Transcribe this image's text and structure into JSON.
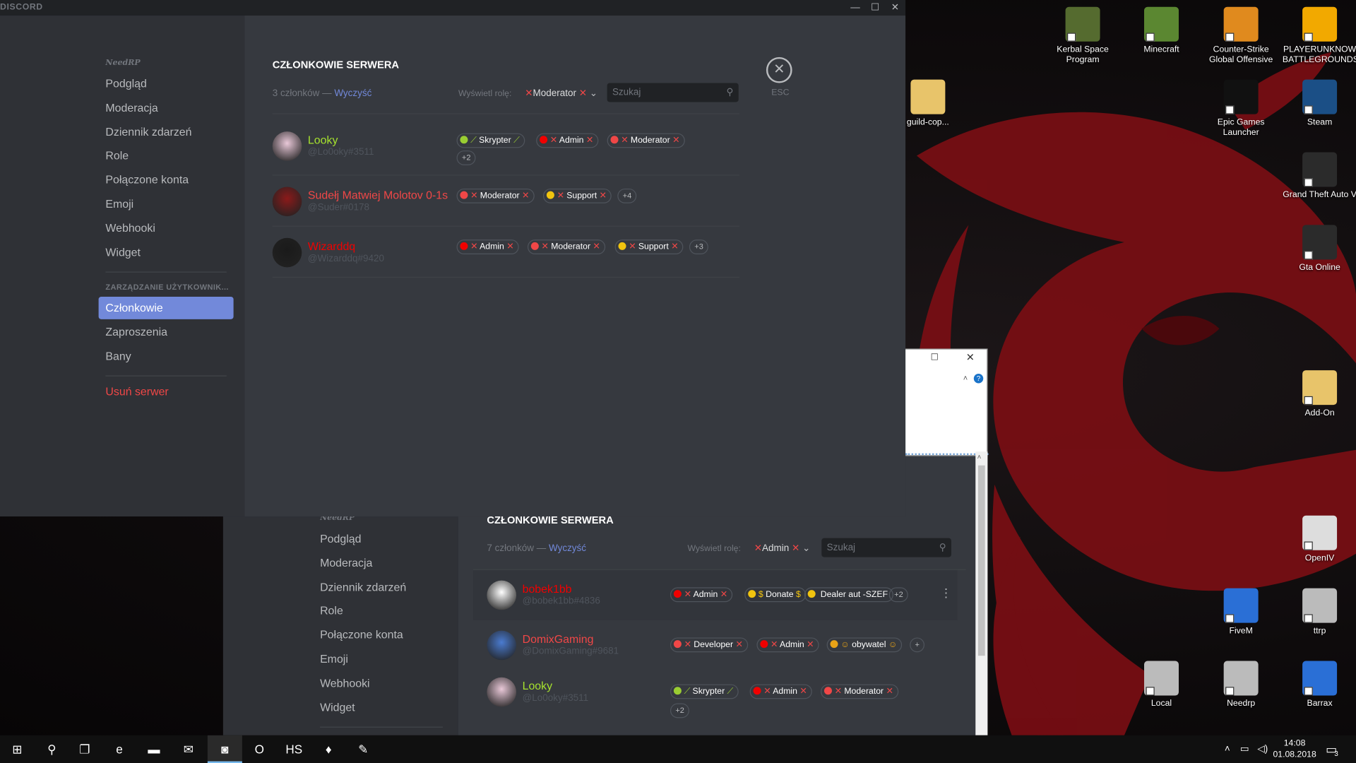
{
  "desktop_icons": [
    {
      "label_lines": [
        "Kerbal Space",
        "Program"
      ],
      "icon": "kerbal-icon",
      "color": "#556b2f"
    },
    {
      "label_lines": [
        "Minecraft"
      ],
      "icon": "minecraft-icon",
      "color": "#5b8731"
    },
    {
      "label_lines": [
        "Counter-Strike",
        "Global Offensive"
      ],
      "icon": "csgo-icon",
      "color": "#e08a1e"
    },
    {
      "label_lines": [
        "PLAYERUNKNOW",
        "BATTLEGROUNDS"
      ],
      "icon": "pubg-icon",
      "color": "#f2a900"
    },
    {
      "label_lines": [
        "Epic Games",
        "Launcher"
      ],
      "icon": "epic-icon",
      "color": "#111111"
    },
    {
      "label_lines": [
        "Steam"
      ],
      "icon": "steam-icon",
      "color": "#1b4f86"
    },
    {
      "label_lines": [
        "Grand Theft Auto V"
      ],
      "icon": "gta-icon",
      "color": "#2b2b2b"
    },
    {
      "label_lines": [
        "Gta Online"
      ],
      "icon": "gta-online-icon",
      "color": "#2b2b2b"
    },
    {
      "label_lines": [
        "Add-On"
      ],
      "icon": "folder-icon",
      "color": "#e8c46a"
    },
    {
      "label_lines": [
        "OpenIV"
      ],
      "icon": "openiv-icon",
      "color": "#dddddd"
    },
    {
      "label_lines": [
        "FiveM"
      ],
      "icon": "fivem-icon",
      "color": "#2a6fd6"
    },
    {
      "label_lines": [
        "ttrp"
      ],
      "icon": "gear-shortcut-icon",
      "color": "#bbbbbb"
    },
    {
      "label_lines": [
        "Local"
      ],
      "icon": "gear-shortcut-icon",
      "color": "#bbbbbb"
    },
    {
      "label_lines": [
        "Needrp"
      ],
      "icon": "gear-shortcut-icon",
      "color": "#bbbbbb"
    },
    {
      "label_lines": [
        "Barrax"
      ],
      "icon": "fivem-icon",
      "color": "#2a6fd6"
    },
    {
      "label_lines": [
        "guild-cop..."
      ],
      "icon": "file-icon",
      "color": "#e8c46a"
    }
  ],
  "discord": {
    "app_name": "DISCORD",
    "window_controls": {
      "minimize": "—",
      "maximize": "☐",
      "close": "✕"
    },
    "front": {
      "server_name": "NeedRP",
      "nav": [
        "Podgląd",
        "Moderacja",
        "Dziennik zdarzeń",
        "Role",
        "Połączone konta",
        "Emoji",
        "Webhooki",
        "Widget"
      ],
      "section_header": "ZARZĄDZANIE UŻYTKOWNIK...",
      "user_nav": [
        "Członkowie",
        "Zaproszenia",
        "Bany"
      ],
      "selected": "Członkowie",
      "delete_server": "Usuń serwer",
      "title": "CZŁONKOWIE SERWERA",
      "count": "3 członków —",
      "clear": "Wyczyść",
      "display_role_label": "Wyświetl rolę:",
      "role_filter": "Moderator",
      "search_placeholder": "Szukaj",
      "close_label": "✕",
      "esc_label": "ESC",
      "members": [
        {
          "name": "Looky",
          "tag": "@Lo0oky#3511",
          "name_color": "#a6e22e",
          "avatar_color": "#e9c8d8",
          "roles": [
            {
              "label": "Skrypter",
              "color": "#9acd32",
              "mark": "⟋"
            },
            {
              "label": "Admin",
              "color": "#f00000",
              "mark": "✕"
            },
            {
              "label": "Moderator",
              "color": "#f04747",
              "mark": "✕"
            }
          ],
          "more": "+2"
        },
        {
          "name": "Sudełj Matwiej Molotov 0-1s",
          "tag": "@Suder#0178",
          "name_color": "#f04747",
          "avatar_color": "#8b1a1a",
          "roles": [
            {
              "label": "Moderator",
              "color": "#f04747",
              "mark": "✕"
            },
            {
              "label": "Support",
              "color": "#f1c40f",
              "mark": "✕"
            }
          ],
          "more": "+4"
        },
        {
          "name": "Wizarddq",
          "tag": "@Wizarddq#9420",
          "name_color": "#f00000",
          "avatar_color": "#1a1a1a",
          "roles": [
            {
              "label": "Admin",
              "color": "#f00000",
              "mark": "✕"
            },
            {
              "label": "Moderator",
              "color": "#f04747",
              "mark": "✕"
            },
            {
              "label": "Support",
              "color": "#f1c40f",
              "mark": "✕"
            }
          ],
          "more": "+3"
        }
      ]
    },
    "back": {
      "server_name": "NeedRP",
      "nav": [
        "Podgląd",
        "Moderacja",
        "Dziennik zdarzeń",
        "Role",
        "Połączone konta",
        "Emoji",
        "Webhooki",
        "Widget"
      ],
      "title": "CZŁONKOWIE SERWERA",
      "count": "7 członków —",
      "clear": "Wyczyść",
      "display_role_label": "Wyświetl rolę:",
      "role_filter": "Admin",
      "search_placeholder": "Szukaj",
      "members": [
        {
          "name": "bobek1bb",
          "tag": "@bobek1bb#4836",
          "name_color": "#f00000",
          "avatar_color": "#ffffff",
          "roles": [
            {
              "label": "Admin",
              "color": "#f00000",
              "prefix": "✕",
              "mark": "✕"
            },
            {
              "label": "Donate",
              "color": "#f1c40f",
              "prefix": "$",
              "mark": "$"
            },
            {
              "label": "Dealer aut -SZEF",
              "color": "#f1c40f",
              "prefix": "",
              "mark": ""
            }
          ],
          "more": "+2"
        },
        {
          "name": "DomixGaming",
          "tag": "@DomixGaming#9681",
          "name_color": "#f04747",
          "avatar_color": "#4a7bd0",
          "roles": [
            {
              "label": "Developer",
              "color": "#f04747",
              "prefix": "✕",
              "mark": "✕"
            },
            {
              "label": "Admin",
              "color": "#f00000",
              "prefix": "✕",
              "mark": "✕"
            },
            {
              "label": "obywatel",
              "color": "#e8a317",
              "prefix": "☺",
              "mark": "☺"
            }
          ],
          "more": "+"
        },
        {
          "name": "Looky",
          "tag": "@Lo0oky#3511",
          "name_color": "#a6e22e",
          "avatar_color": "#e9c8d8",
          "roles": [
            {
              "label": "Skrypter",
              "color": "#9acd32",
              "prefix": "⟋",
              "mark": "⟋"
            },
            {
              "label": "Admin",
              "color": "#f00000",
              "prefix": "✕",
              "mark": "✕"
            },
            {
              "label": "Moderator",
              "color": "#f04747",
              "prefix": "✕",
              "mark": "✕"
            }
          ],
          "more": "+2"
        }
      ]
    }
  },
  "taskbar": {
    "items": [
      {
        "icon": "windows-start-icon",
        "glyph": "⊞"
      },
      {
        "icon": "search-icon",
        "glyph": "⚲"
      },
      {
        "icon": "task-view-icon",
        "glyph": "❐"
      },
      {
        "icon": "edge-icon",
        "glyph": "e"
      },
      {
        "icon": "file-explorer-icon",
        "glyph": "▬"
      },
      {
        "icon": "mail-icon",
        "glyph": "✉"
      },
      {
        "icon": "discord-icon",
        "glyph": "◙"
      },
      {
        "icon": "opera-icon",
        "glyph": "O"
      },
      {
        "icon": "hs-icon",
        "glyph": "HS"
      },
      {
        "icon": "microphone-icon",
        "glyph": "♦"
      },
      {
        "icon": "paint-icon",
        "glyph": "✎"
      }
    ],
    "active_index": 6,
    "tray_icons": [
      "chevron-up-icon",
      "network-icon",
      "volume-icon"
    ],
    "time": "14:08",
    "date": "01.08.2018",
    "notification_count": "3"
  }
}
